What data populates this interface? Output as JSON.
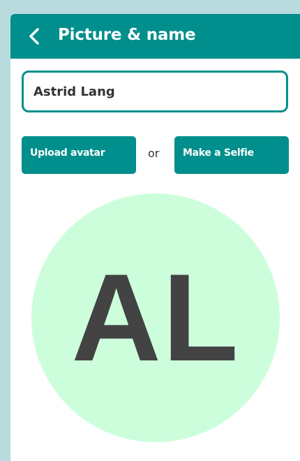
{
  "header": {
    "title": "Picture & name",
    "back_icon": "chevron-left-icon"
  },
  "name_field": {
    "value": "Astrid Lang"
  },
  "actions": {
    "upload_label": "Upload avatar",
    "separator": "or",
    "selfie_label": "Make a Selfie"
  },
  "avatar": {
    "initials": "AL"
  },
  "colors": {
    "accent": "#008f8c",
    "avatar_bg": "#ccfedc",
    "initials": "#434343",
    "page_bg": "#b9dbde"
  }
}
